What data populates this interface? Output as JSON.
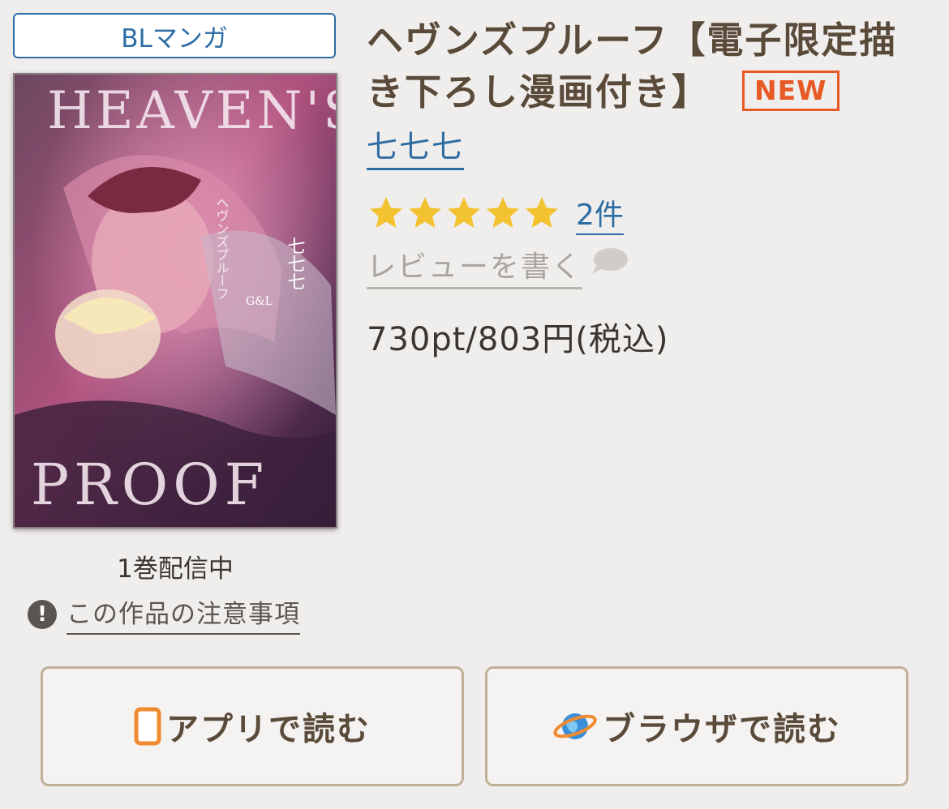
{
  "genre": {
    "label": "BLマンガ"
  },
  "cover": {
    "alt_text": "HEAVEN'S PROOF",
    "author_vertical": "七七七",
    "title_vertical": "ヘヴンズプルーフ",
    "imprint": "G&L"
  },
  "volumes": {
    "status": "1巻配信中"
  },
  "notes": {
    "label": "この作品の注意事項",
    "icon": "exclamation-icon"
  },
  "title": {
    "text": "ヘヴンズプルーフ【電子限定描き下ろし漫画付き】",
    "badge": "NEW"
  },
  "author": {
    "name": "七七七"
  },
  "rating": {
    "stars": 5,
    "max": 5,
    "review_count": "2件"
  },
  "review": {
    "write_label": "レビューを書く"
  },
  "price": {
    "text": "730pt/803円(税込)"
  },
  "actions": {
    "app_label": "アプリで読む",
    "app_icon": "tablet-icon",
    "browser_label": "ブラウザで読む",
    "browser_icon": "globe-icon"
  },
  "colors": {
    "background": "#f0eeec",
    "link": "#2e6da4",
    "title": "#5a4a3a",
    "new_badge": "#e85a25",
    "star": "#f2c230",
    "button_border": "#c0b098"
  }
}
